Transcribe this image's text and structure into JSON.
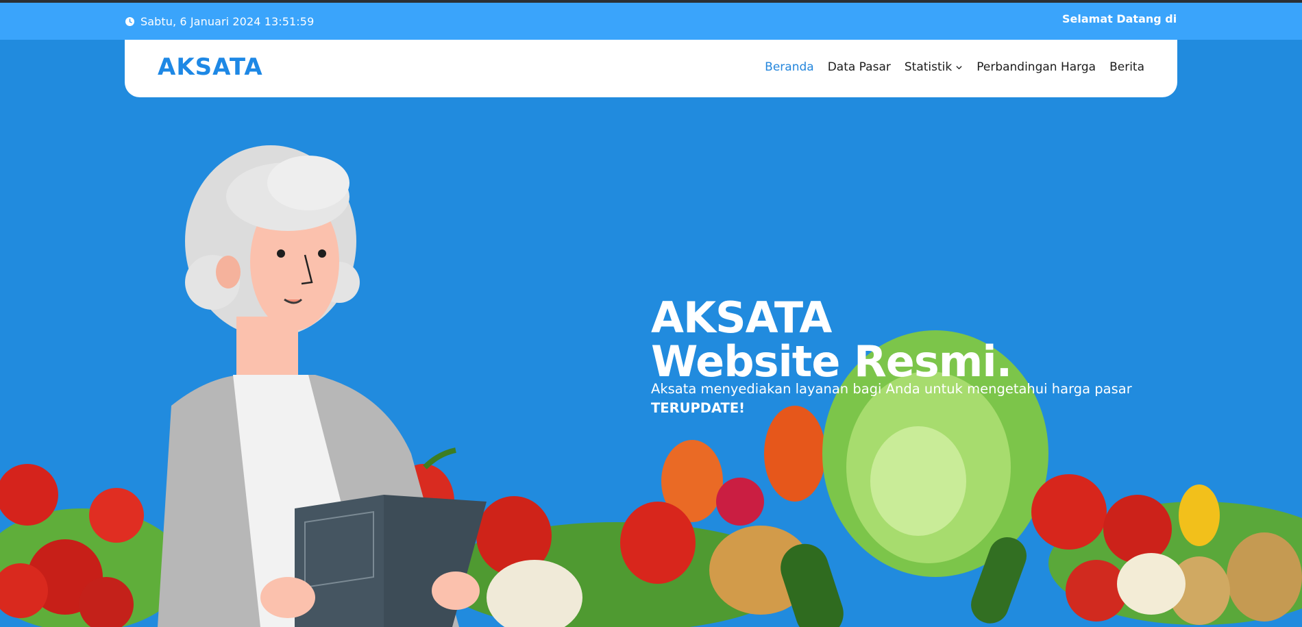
{
  "topbar": {
    "datetime": "Sabtu, 6 Januari 2024 13:51:59",
    "marquee_text": "Selamat Datang di AKSATA",
    "clock_icon": "clock-icon"
  },
  "navbar": {
    "logo": "AKSATA",
    "menu": [
      {
        "label": "Beranda",
        "active": true
      },
      {
        "label": "Data Pasar",
        "active": false
      },
      {
        "label": "Statistik",
        "active": false,
        "dropdown": true
      },
      {
        "label": "Perbandingan Harga",
        "active": false
      },
      {
        "label": "Berita",
        "active": false
      }
    ]
  },
  "hero": {
    "title_line1": "AKSATA",
    "title_line2": "Website Resmi.",
    "description": "Aksata menyediakan layanan bagi Anda untuk mengetahui harga pasar",
    "highlight": "TERUPDATE!"
  },
  "colors": {
    "background": "#218bde",
    "topbar": "#3aa4fb",
    "brand": "#1e88e5",
    "active_link": "#2486dc"
  }
}
